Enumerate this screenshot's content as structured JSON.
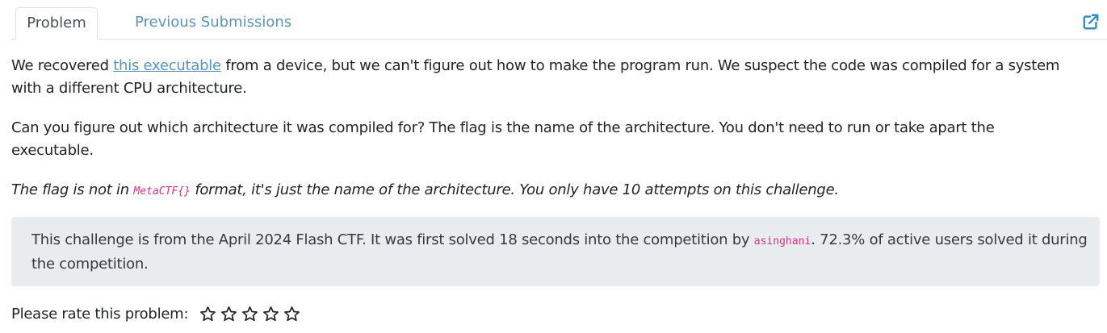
{
  "tabs": {
    "problem": "Problem",
    "previous_submissions": "Previous Submissions"
  },
  "icons": {
    "external_link": "external-link-icon",
    "star": "star-outline-icon"
  },
  "colors": {
    "link": "#5a95b8",
    "code": "#d63384",
    "info_background": "#e9ecef"
  },
  "description": {
    "p1_before": "We recovered ",
    "p1_link": "this executable",
    "p1_after": " from a device, but we can't figure out how to make the program run. We suspect the code was compiled for a system with a different CPU architecture.",
    "p2": "Can you figure out which architecture it was compiled for? The flag is the name of the architecture. You don't need to run or take apart the executable.",
    "p3_before": "The flag is not in ",
    "p3_code": "MetaCTF{}",
    "p3_after": " format, it's just the name of the architecture. You only have 10 attempts on this challenge."
  },
  "info": {
    "before": "This challenge is from the April 2024 Flash CTF. It was first solved 18 seconds into the competition by ",
    "user": "asinghani",
    "after": ". 72.3% of active users solved it during the competition."
  },
  "rating": {
    "label": "Please rate this problem:",
    "max_stars": 5,
    "current": 0
  }
}
